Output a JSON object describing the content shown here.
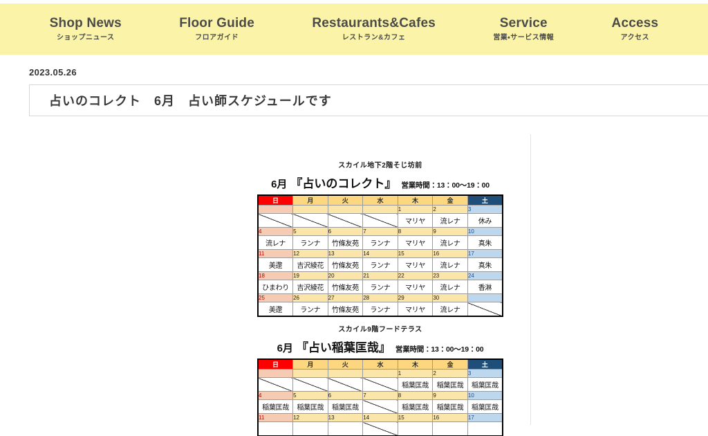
{
  "nav": {
    "items": [
      {
        "en": "Shop News",
        "ja": "ショップニュース"
      },
      {
        "en": "Floor Guide",
        "ja": "フロアガイド"
      },
      {
        "en": "Restaurants&Cafes",
        "ja": "レストラン&カフェ"
      },
      {
        "en": "Service",
        "ja": "営業・サービス情報"
      },
      {
        "en": "Access",
        "ja": "アクセス"
      }
    ],
    "background_color": "#fbf4a8"
  },
  "article": {
    "date": "2023.05.26",
    "title": "占いのコレクト　6月　占い師スケジュールです"
  },
  "schedules": [
    {
      "venue": "スカイル地下2階そじ坊前",
      "month": "6月",
      "name": "『占いのコレクト』",
      "hours": "営業時間：13：00〜19：00",
      "dow": [
        "日",
        "月",
        "火",
        "水",
        "木",
        "金",
        "土"
      ],
      "weeks": [
        {
          "nums": [
            "",
            "",
            "",
            "",
            "1",
            "2",
            "3"
          ],
          "vals": [
            "",
            "",
            "",
            "",
            "マリヤ",
            "流レナ",
            "休み"
          ]
        },
        {
          "nums": [
            "4",
            "5",
            "6",
            "7",
            "8",
            "9",
            "10"
          ],
          "vals": [
            "流レナ",
            "ランナ",
            "竹條友苑",
            "ランナ",
            "マリヤ",
            "流レナ",
            "真朱"
          ]
        },
        {
          "nums": [
            "11",
            "12",
            "13",
            "14",
            "15",
            "16",
            "17"
          ],
          "vals": [
            "美邌",
            "吉沢綾花",
            "竹條友苑",
            "ランナ",
            "マリヤ",
            "流レナ",
            "真朱"
          ]
        },
        {
          "nums": [
            "18",
            "19",
            "20",
            "21",
            "22",
            "23",
            "24"
          ],
          "vals": [
            "ひまわり",
            "吉沢綾花",
            "竹條友苑",
            "ランナ",
            "マリヤ",
            "流レナ",
            "香淋"
          ]
        },
        {
          "nums": [
            "25",
            "26",
            "27",
            "28",
            "29",
            "30",
            ""
          ],
          "vals": [
            "美邌",
            "ランナ",
            "竹條友苑",
            "ランナ",
            "マリヤ",
            "流レナ",
            ""
          ]
        }
      ]
    },
    {
      "venue": "スカイル9階フードテラス",
      "month": "6月",
      "name": "『占い稲葉匡哉』",
      "hours": "営業時間：13：00〜19：00",
      "dow": [
        "日",
        "月",
        "火",
        "水",
        "木",
        "金",
        "土"
      ],
      "weeks": [
        {
          "nums": [
            "",
            "",
            "",
            "",
            "1",
            "2",
            "3"
          ],
          "vals": [
            "",
            "",
            "",
            "",
            "稲葉匡哉",
            "稲葉匡哉",
            "稲葉匡哉"
          ]
        },
        {
          "nums": [
            "4",
            "5",
            "6",
            "7",
            "8",
            "9",
            "10"
          ],
          "vals": [
            "稲葉匡哉",
            "稲葉匡哉",
            "稲葉匡哉",
            "",
            "稲葉匡哉",
            "稲葉匡哉",
            "稲葉匡哉"
          ]
        },
        {
          "nums": [
            "11",
            "12",
            "13",
            "14",
            "15",
            "16",
            "17"
          ],
          "vals": [
            "",
            "",
            "",
            "",
            "",
            "",
            ""
          ]
        }
      ]
    }
  ],
  "colors": {
    "nav_bg": "#fbf4a8",
    "sunday_header": "#ff0000",
    "weekday_header": "#fcd77f",
    "saturday_header": "#1f4e79",
    "sunday_num": "#f5cbb4",
    "weekday_num": "#fce5a8",
    "saturday_num": "#bdd7ee"
  }
}
